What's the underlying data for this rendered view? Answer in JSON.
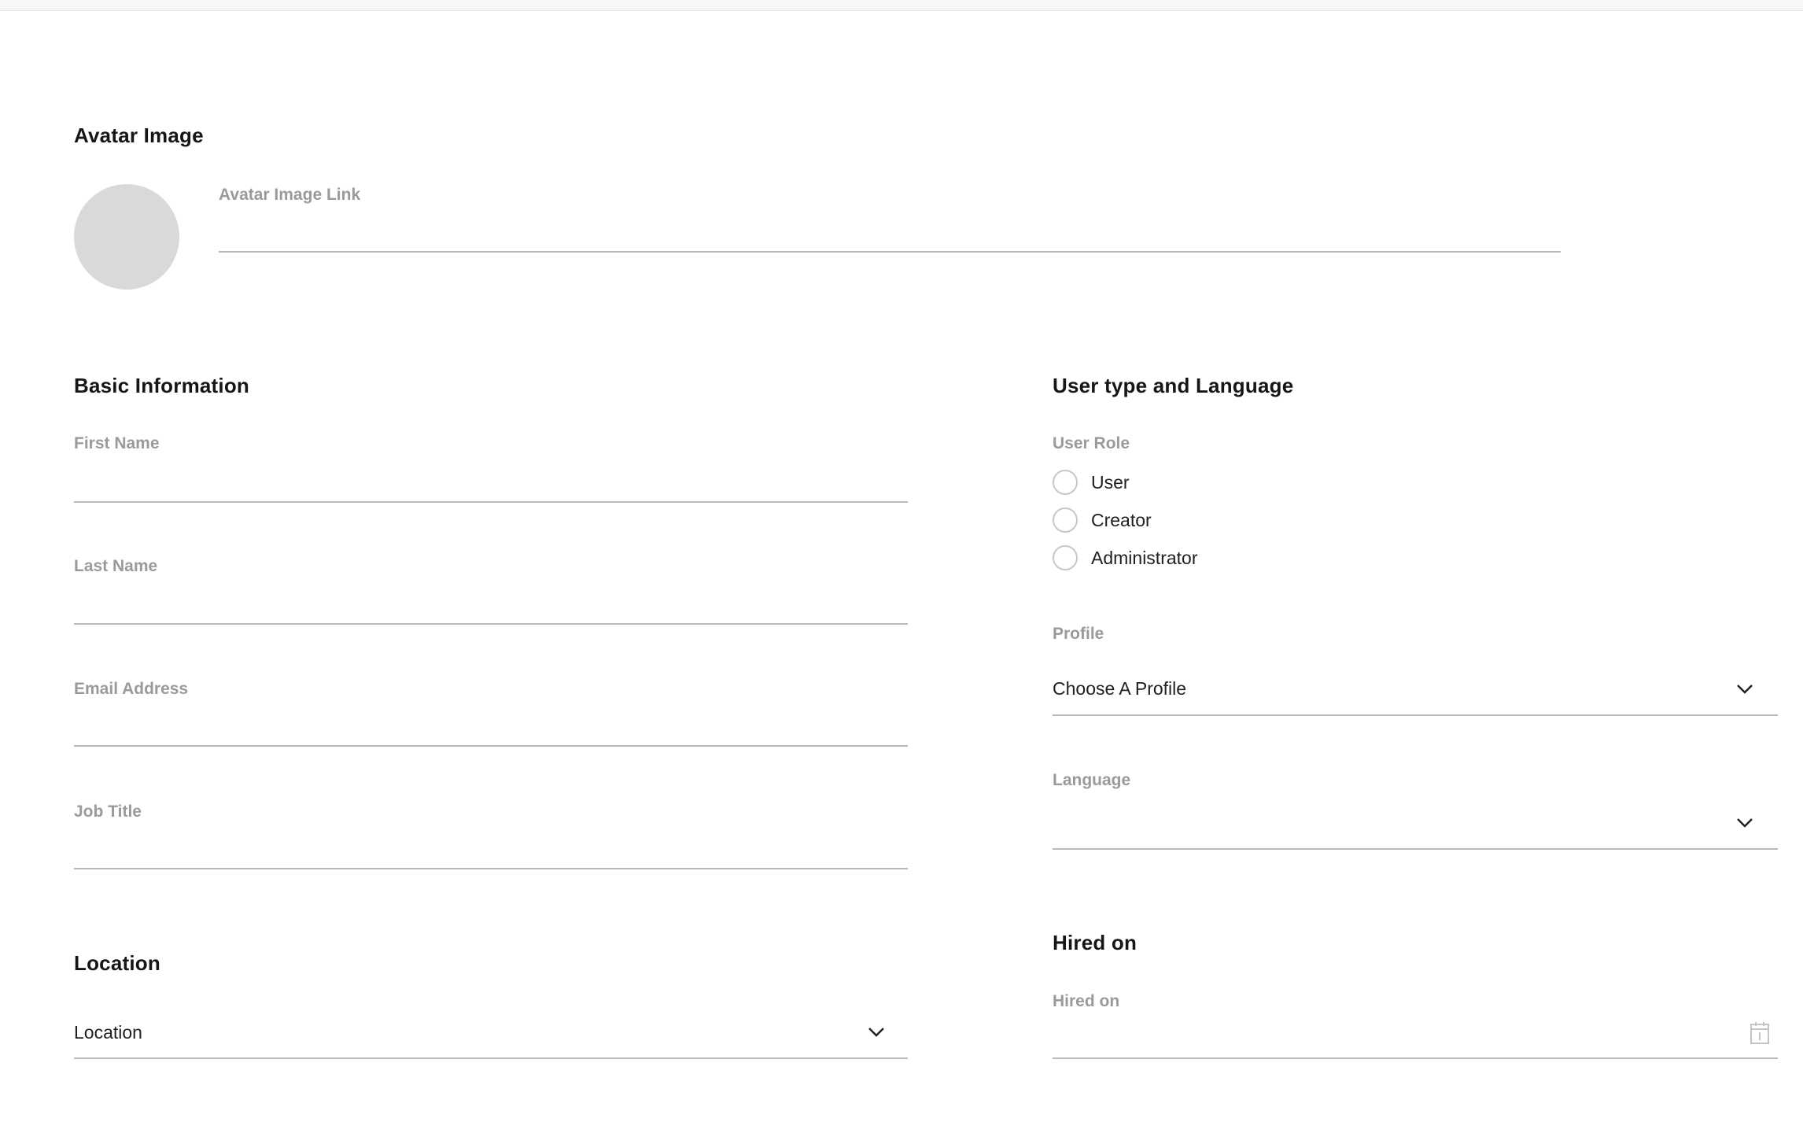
{
  "avatar_section": {
    "title": "Avatar Image",
    "link_label": "Avatar Image Link",
    "link_value": ""
  },
  "basic_info": {
    "title": "Basic Information",
    "first_name_label": "First Name",
    "first_name_value": "",
    "last_name_label": "Last Name",
    "last_name_value": "",
    "email_label": "Email Address",
    "email_value": "",
    "job_title_label": "Job Title",
    "job_title_value": ""
  },
  "user_type": {
    "title": "User type and Language",
    "role_label": "User Role",
    "roles": [
      {
        "label": "User",
        "selected": false
      },
      {
        "label": "Creator",
        "selected": false
      },
      {
        "label": "Administrator",
        "selected": false
      }
    ],
    "profile_label": "Profile",
    "profile_value": "Choose A Profile",
    "language_label": "Language",
    "language_value": ""
  },
  "location": {
    "title": "Location",
    "value": "Location"
  },
  "hired": {
    "title": "Hired on",
    "field_label": "Hired on",
    "value": ""
  },
  "icons": {
    "profile_dropdown": "chevron-down-icon",
    "language_dropdown": "chevron-down-icon",
    "location_dropdown": "chevron-down-icon",
    "date_picker": "calendar-icon"
  },
  "colors": {
    "label": "#9a9a9a",
    "underline": "#b9b9b9",
    "avatar_placeholder": "#d9d9d9",
    "radio_border": "#c8c8c8"
  }
}
